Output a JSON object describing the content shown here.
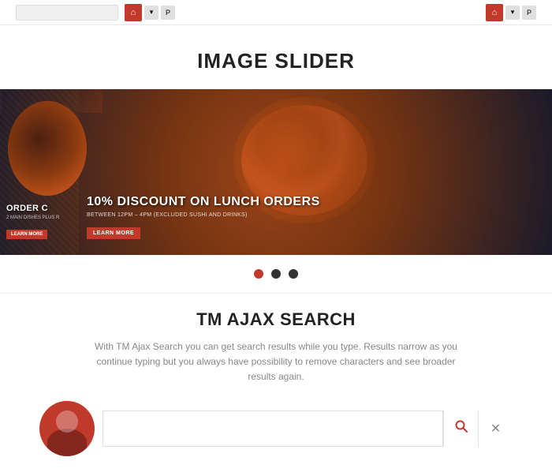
{
  "toolbar": {
    "btn1_label": "⌂",
    "btn2_label": "▾",
    "btn3_label": "P",
    "btn4_label": "⌂",
    "btn5_label": "▾",
    "btn6_label": "P"
  },
  "image_slider": {
    "section_title": "IMAGE SLIDER",
    "slide1": {
      "title": "10% DISCOUNT ON LUNCH ORDERS",
      "subtitle": "BETWEEN 12PM – 4PM (EXCLUDED SUSHI AND DRINKS)",
      "btn_label": "LEARN MORE"
    },
    "slide2": {
      "title": "ORDER C",
      "subtitle": "2 MAIN DISHES PLUS R",
      "btn_label": "LEARN MORE"
    },
    "dots": [
      {
        "active": true
      },
      {
        "active": false
      },
      {
        "active": false
      }
    ]
  },
  "ajax_search": {
    "section_title": "TM AJAX SEARCH",
    "description": "With TM Ajax Search you can get search results while you type. Results narrow as you continue typing but you always have possibility to remove characters and see broader results again.",
    "search_placeholder": "",
    "search_icon": "🔍",
    "close_icon": "✕"
  }
}
